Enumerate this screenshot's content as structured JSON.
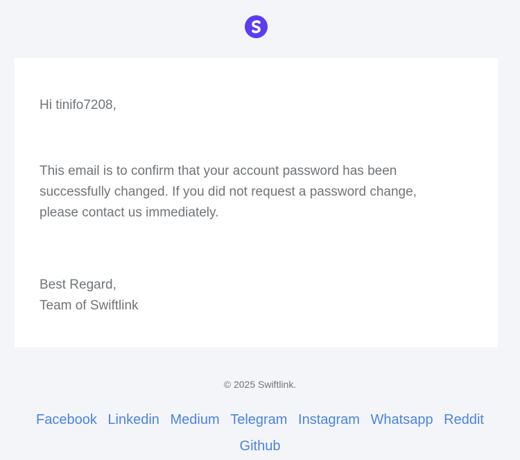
{
  "header": {
    "logo_icon": "swiftlink-s-logo-icon",
    "logo_color": "#5b3cf2"
  },
  "email": {
    "greeting": "Hi tinifo7208,",
    "message": "This email is to confirm that your account password has been successfully changed. If you did not request a password change, please contact us immediately.",
    "signoff_line1": "Best Regard,",
    "signoff_line2": "Team of Swiftlink"
  },
  "footer": {
    "copyright": "© 2025 Swiftlink.",
    "links": [
      {
        "label": "Facebook"
      },
      {
        "label": "Linkedin"
      },
      {
        "label": "Medium"
      },
      {
        "label": "Telegram"
      },
      {
        "label": "Instagram"
      },
      {
        "label": "Whatsapp"
      },
      {
        "label": "Reddit"
      },
      {
        "label": "Github"
      }
    ],
    "link_color": "#4a83e0"
  }
}
